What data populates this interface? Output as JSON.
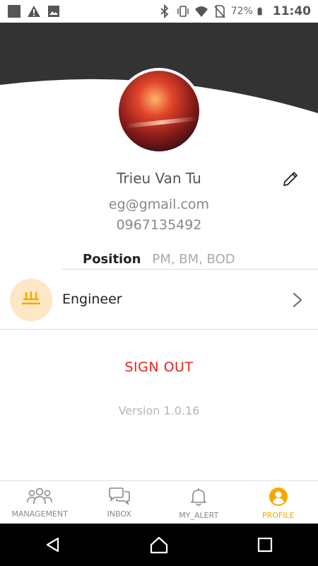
{
  "status_bar": {
    "battery_text": "72%",
    "time": "11:40",
    "left_icons": [
      "gallery-square-icon",
      "warning-icon",
      "image-icon"
    ],
    "right_icons": [
      "bluetooth-icon",
      "vibrate-icon",
      "wifi-icon",
      "no-sim-icon",
      "battery-icon"
    ]
  },
  "profile": {
    "name": "Trieu Van Tu",
    "email": "eg@gmail.com",
    "phone": "0967135492",
    "position_label": "Position",
    "position_value": "PM, BM, BOD",
    "role": "Engineer"
  },
  "actions": {
    "sign_out": "SIGN OUT",
    "version": "Version 1.0.16"
  },
  "bottom_nav": {
    "items": [
      {
        "label": "MANAGEMENT",
        "icon": "people-group-icon"
      },
      {
        "label": "INBOX",
        "icon": "chat-bubbles-icon"
      },
      {
        "label": "MY_ALERT",
        "icon": "bell-icon"
      },
      {
        "label": "PROFILE",
        "icon": "user-circle-icon"
      }
    ],
    "active_index": 3
  },
  "colors": {
    "header_bg": "#333333",
    "accent": "#f5a800",
    "sign_out": "#e8231f",
    "role_icon_bg": "#fde7c4"
  }
}
